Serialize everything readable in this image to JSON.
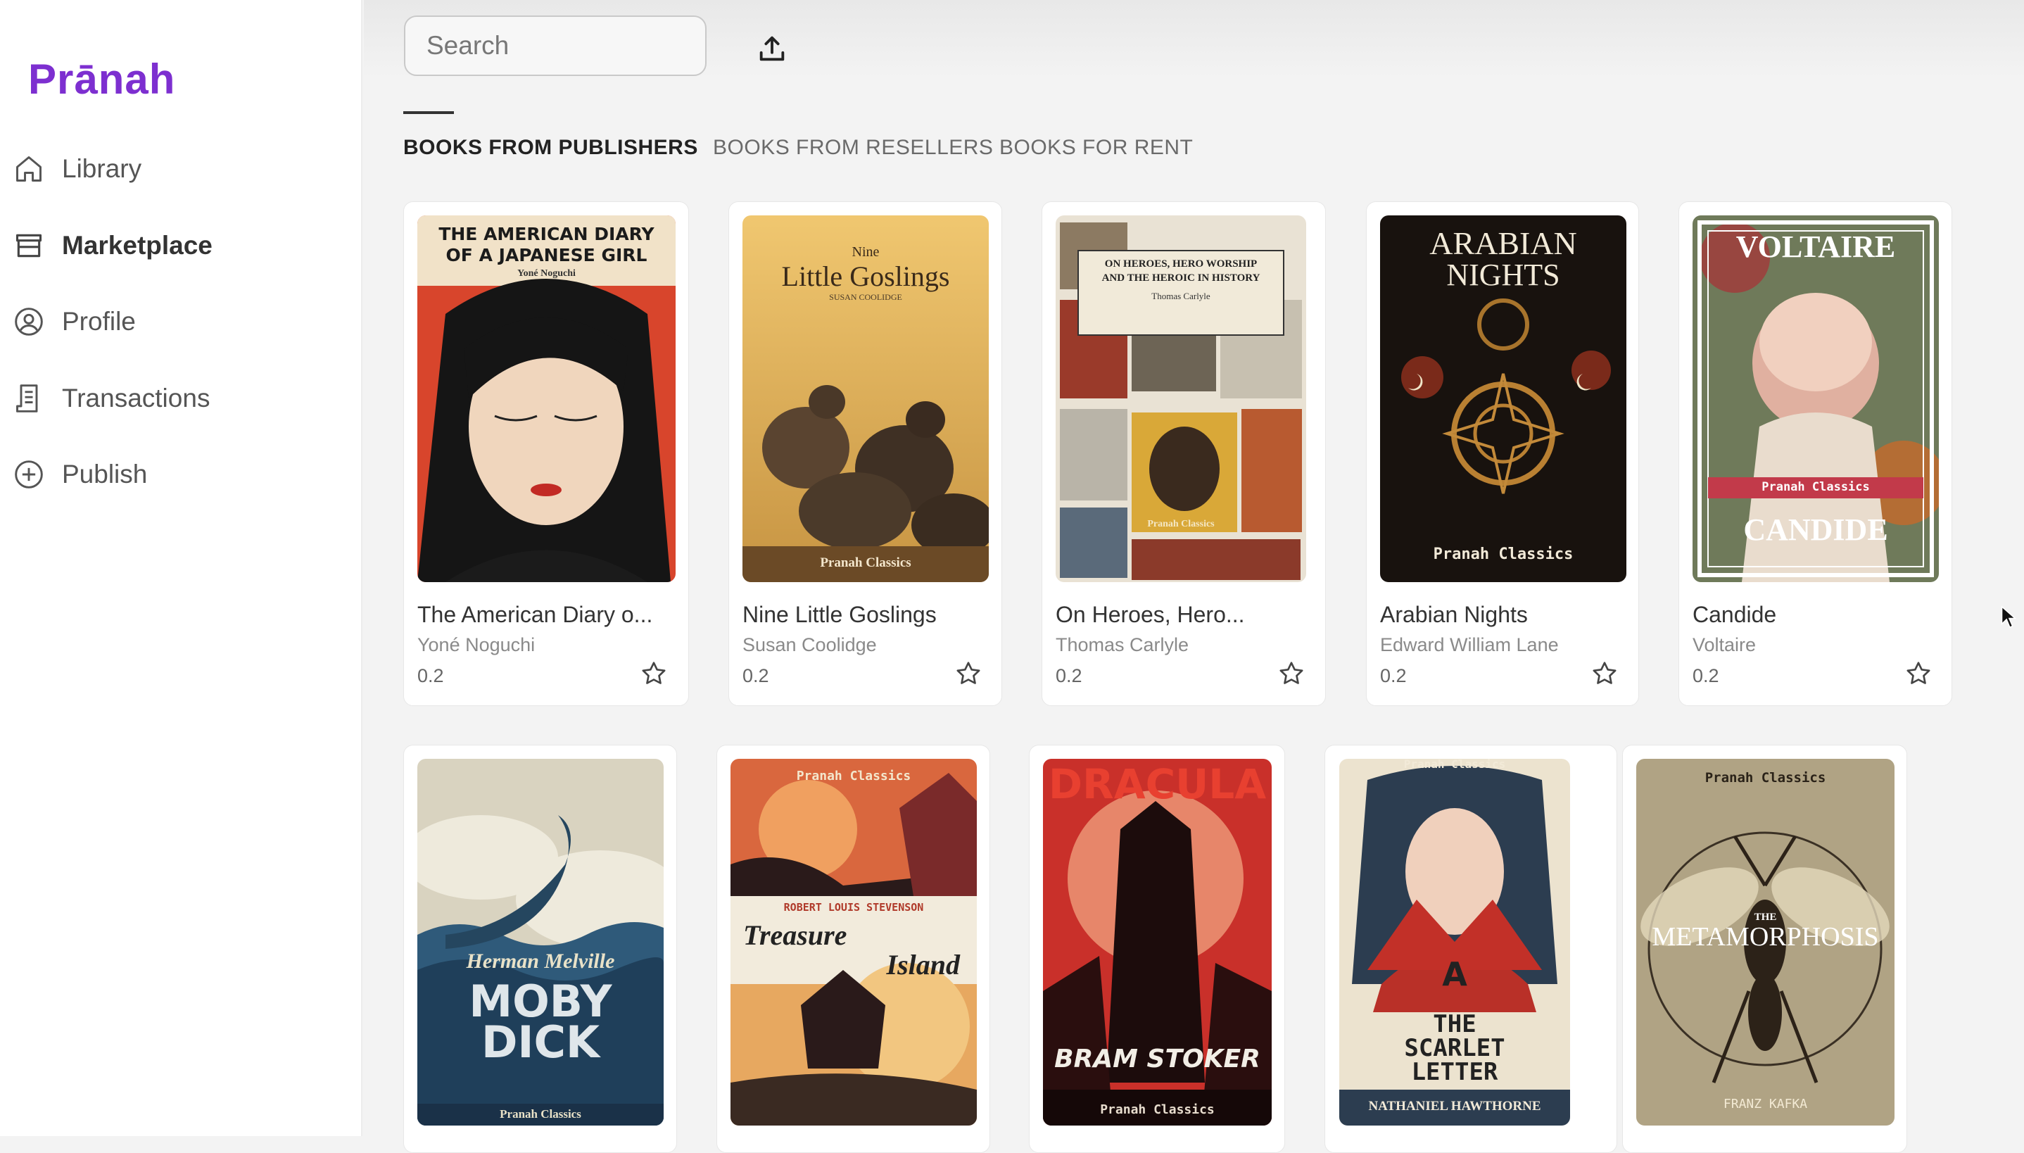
{
  "app": {
    "logo": "Prānah",
    "brand_color": "#7d2fd0"
  },
  "sidebar": {
    "items": [
      {
        "label": "Library",
        "icon": "home-icon",
        "active": false
      },
      {
        "label": "Marketplace",
        "icon": "store-icon",
        "active": true
      },
      {
        "label": "Profile",
        "icon": "user-circle-icon",
        "active": false
      },
      {
        "label": "Transactions",
        "icon": "receipt-icon",
        "active": false
      },
      {
        "label": "Publish",
        "icon": "plus-circle-icon",
        "active": false
      }
    ]
  },
  "search": {
    "placeholder": "Search",
    "value": ""
  },
  "toolbar": {
    "upload_icon": "upload-icon"
  },
  "tabs": [
    {
      "label": "BOOKS FROM PUBLISHERS",
      "active": true
    },
    {
      "label": "BOOKS FROM RESELLERS",
      "active": false
    },
    {
      "label": "BOOKS FOR RENT",
      "active": false
    }
  ],
  "books_row1": [
    {
      "title": "The American Diary o...",
      "author": "Yoné Noguchi",
      "price": "0.2",
      "cover_lines": [
        "THE AMERICAN DIARY",
        "OF A JAPANESE GIRL",
        "Yoné Noguchi"
      ]
    },
    {
      "title": "Nine Little Goslings",
      "author": "Susan Coolidge",
      "price": "0.2",
      "cover_lines": [
        "Nine",
        "Little Goslings",
        "SUSAN COOLIDGE",
        "Pranah Classics"
      ]
    },
    {
      "title": "On Heroes, Hero...",
      "author": "Thomas Carlyle",
      "price": "0.2",
      "cover_lines": [
        "ON HEROES, HERO WORSHIP",
        "AND THE HEROIC IN HISTORY",
        "Thomas Carlyle",
        "Pranah Classics"
      ]
    },
    {
      "title": "Arabian Nights",
      "author": "Edward William Lane",
      "price": "0.2",
      "cover_lines": [
        "ARABIAN",
        "NIGHTS",
        "Pranah Classics"
      ]
    },
    {
      "title": "Candide",
      "author": "Voltaire",
      "price": "0.2",
      "cover_lines": [
        "VOLTAIRE",
        "Pranah Classics",
        "CANDIDE"
      ]
    }
  ],
  "books_row2": [
    {
      "cover_lines": [
        "Herman Melville",
        "MOBY",
        "DICK",
        "Pranah Classics"
      ]
    },
    {
      "cover_lines": [
        "Pranah Classics",
        "ROBERT LOUIS STEVENSON",
        "Treasure",
        "Island"
      ]
    },
    {
      "cover_lines": [
        "DRACULA",
        "BRAM STOKER",
        "Pranah Classics"
      ]
    },
    {
      "cover_lines": [
        "Pranah Classics",
        "A",
        "THE",
        "SCARLET",
        "LETTER",
        "NATHANIEL HAWTHORNE"
      ]
    },
    {
      "cover_lines": [
        "Pranah Classics",
        "THE",
        "METAMORPHOSIS",
        "FRANZ KAFKA"
      ]
    }
  ]
}
